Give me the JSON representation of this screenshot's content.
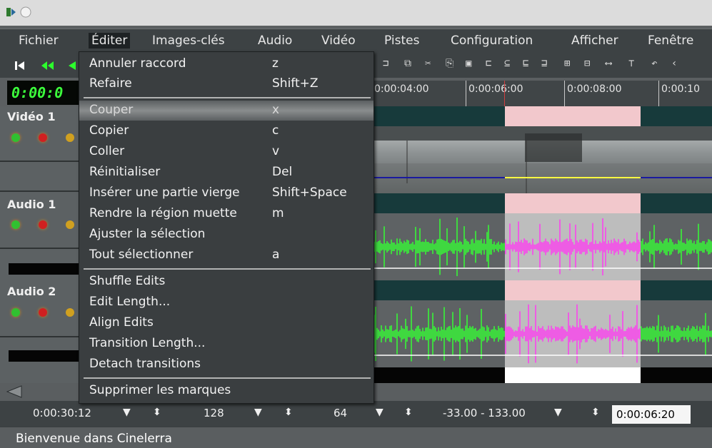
{
  "menubar": {
    "items": [
      "Fichier",
      "Éditer",
      "Images-clés",
      "Audio",
      "Vidéo",
      "Pistes",
      "Configuration",
      "Afficher",
      "Fenêtre"
    ]
  },
  "clock": "0:00:0",
  "ruler": {
    "ticks": [
      "0:00:04:00",
      "0:00:06:00",
      "0:00:08:00",
      "0:00:10"
    ]
  },
  "tracks": [
    "Vidéo 1",
    "Audio 1",
    "Audio 2"
  ],
  "edit_menu": {
    "items": [
      {
        "label": "Annuler raccord",
        "key": "z"
      },
      {
        "label": "Refaire",
        "key": "Shift+Z"
      },
      {
        "label": "Couper",
        "key": "x"
      },
      {
        "label": "Copier",
        "key": "c"
      },
      {
        "label": "Coller",
        "key": "v"
      },
      {
        "label": "Réinitialiser",
        "key": "Del"
      },
      {
        "label": "Insérer une partie vierge",
        "key": "Shift+Space"
      },
      {
        "label": "Rendre la région muette",
        "key": "m"
      },
      {
        "label": "Ajuster la sélection",
        "key": ""
      },
      {
        "label": "Tout sélectionner",
        "key": "a"
      },
      {
        "label": "Shuffle Edits",
        "key": ""
      },
      {
        "label": "Edit Length...",
        "key": ""
      },
      {
        "label": "Align Edits",
        "key": ""
      },
      {
        "label": "Transition Length...",
        "key": ""
      },
      {
        "label": "Detach transitions",
        "key": ""
      },
      {
        "label": "Supprimer les marques",
        "key": ""
      }
    ],
    "highlighted": "Couper"
  },
  "zoombar": {
    "sample_zoom": "0:00:30:12",
    "amp_zoom": "128",
    "track_zoom": "64",
    "range": "-33.00 - 133.00",
    "position": "0:00:06:20"
  },
  "status": "Bienvenue dans Cinelerra",
  "colors": {
    "accent_green": "#3cff3c",
    "wave_green": "#35ff35",
    "wave_magenta": "#ff3cf0",
    "selection_pink": "#f2c8cc"
  }
}
